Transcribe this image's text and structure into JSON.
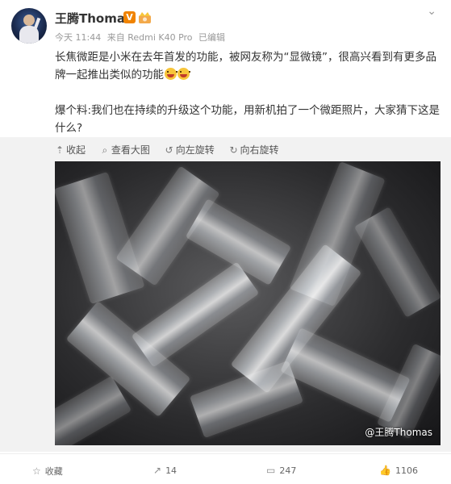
{
  "author": {
    "name": "王腾Thomas",
    "verified_badge": "V"
  },
  "meta": {
    "time": "今天 11:44",
    "source": "来自 Redmi K40 Pro",
    "edited": "已编辑"
  },
  "post": {
    "paragraph1": "长焦微距是小米在去年首发的功能，被网友称为“显微镜”，很高兴看到有更多品牌一起推出类似的功能",
    "paragraph2": "爆个料:我们也在持续的升级这个功能，用新机拍了一个微距照片，大家猜下这是什么?"
  },
  "media_toolbar": {
    "collapse": "收起",
    "view_large": "查看大图",
    "rotate_left": "向左旋转",
    "rotate_right": "向右旋转"
  },
  "image": {
    "watermark": "@王腾Thomas",
    "icons": {
      "collapse": "arrow-up-icon",
      "view_large": "search-icon",
      "rotate_left": "rotate-left-icon",
      "rotate_right": "rotate-right-icon"
    }
  },
  "actions": {
    "favorite": "收藏",
    "repost": "14",
    "comment": "247",
    "like": "1106"
  },
  "colors": {
    "verified_orange": "#f08300",
    "text": "#333333",
    "muted": "#999999",
    "media_bg": "#f2f2f2"
  }
}
